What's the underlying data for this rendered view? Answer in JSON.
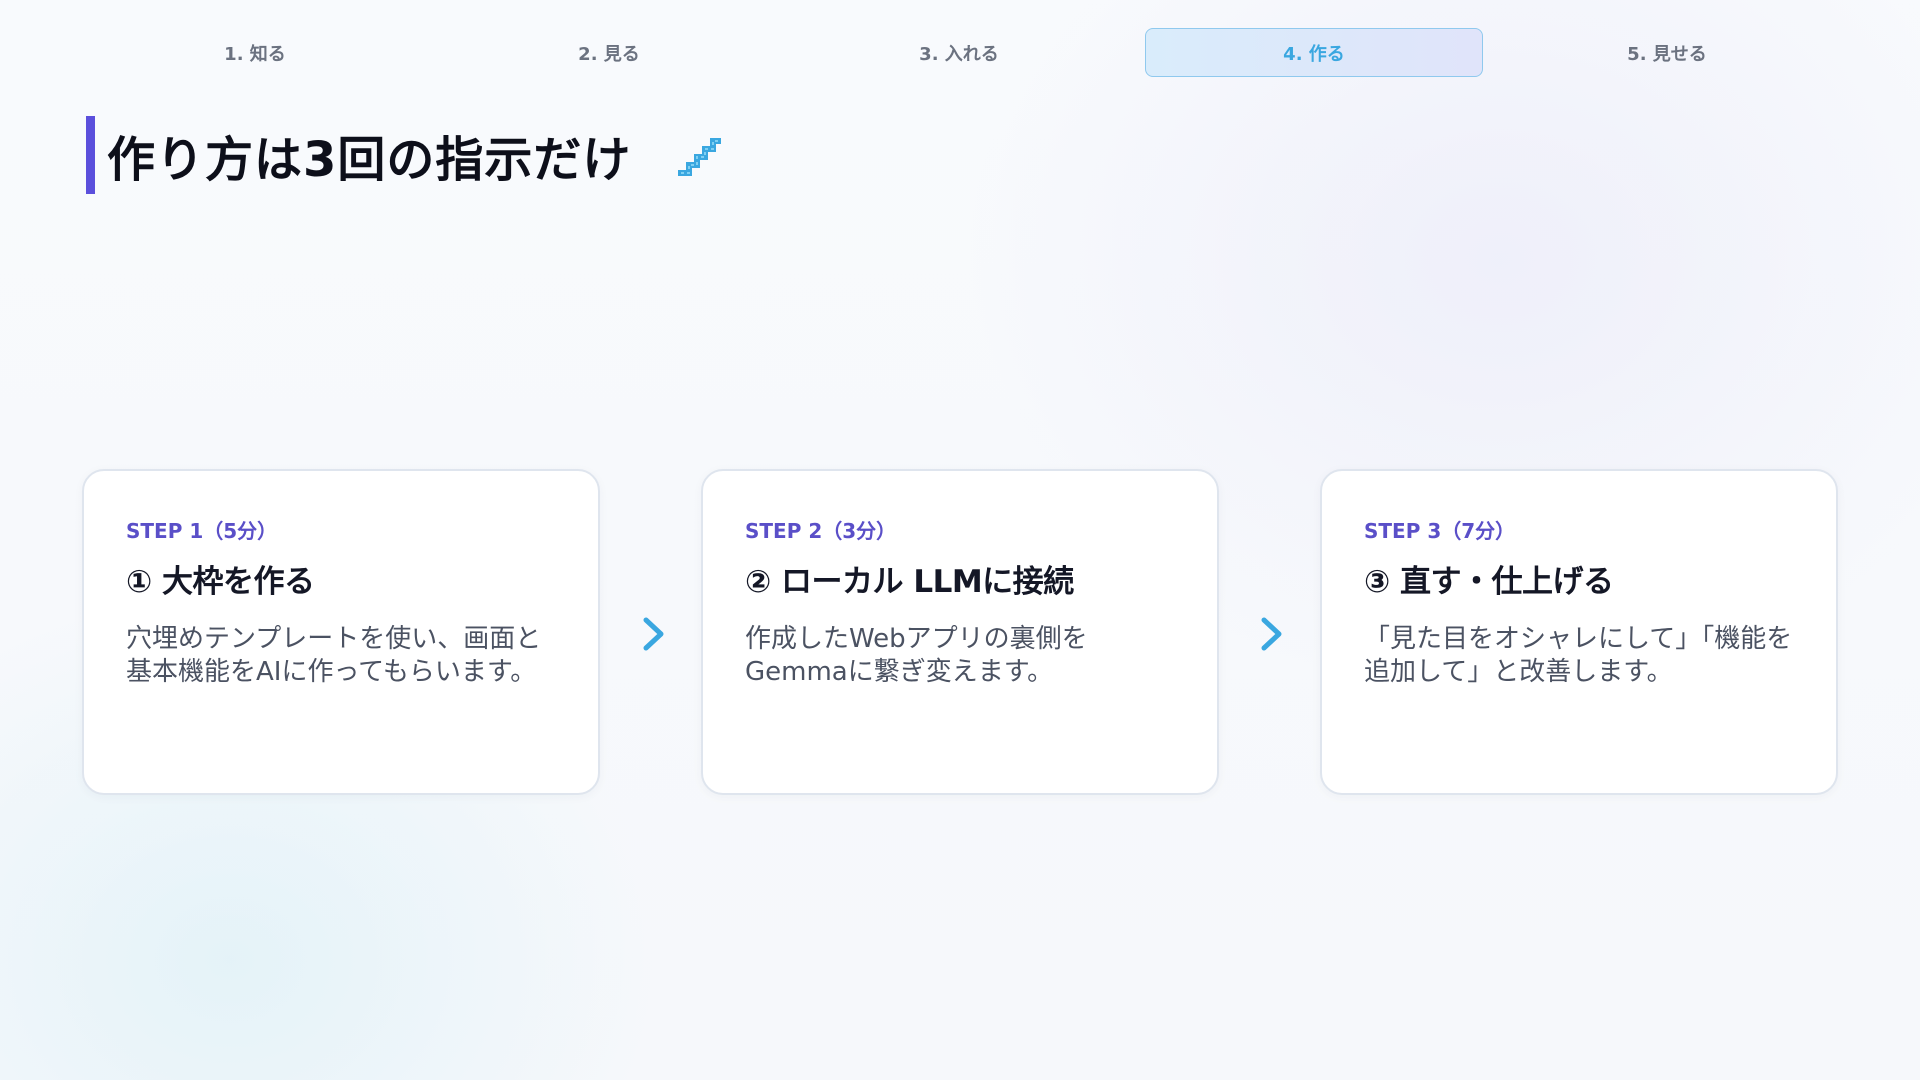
{
  "nav": {
    "tabs": [
      {
        "label": "1. 知る",
        "active": false
      },
      {
        "label": "2. 見る",
        "active": false
      },
      {
        "label": "3. 入れる",
        "active": false
      },
      {
        "label": "4. 作る",
        "active": true
      },
      {
        "label": "5. 見せる",
        "active": false
      }
    ]
  },
  "page": {
    "title": "作り方は3回の指示だけ",
    "title_icon": "stairs-icon"
  },
  "steps": [
    {
      "label": "STEP 1（5分）",
      "title": "① 大枠を作る",
      "desc": "穴埋めテンプレートを使い、画面と基本機能をAIに作ってもらいます。"
    },
    {
      "label": "STEP 2（3分）",
      "title": "② ローカル LLMに接続",
      "desc": "作成したWebアプリの裏側をGemmaに繋ぎ変えます。"
    },
    {
      "label": "STEP 3（7分）",
      "title": "③ 直す・仕上げる",
      "desc": "「見た目をオシャレにして」「機能を追加して」と改善します。"
    }
  ],
  "arrow_icon": "chevron-right-icon",
  "colors": {
    "accent": "#5b4fdc",
    "step_label": "#5a4fc8",
    "arrow": "#3aa7e0",
    "active_tab_text": "#3aa7e0",
    "active_tab_border": "#8fc9ee"
  }
}
